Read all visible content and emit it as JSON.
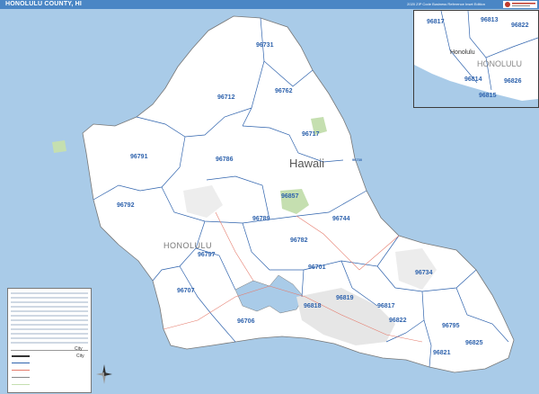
{
  "header": {
    "title": "HONOLULU COUNTY, HI",
    "subtitle": "2020 ZIP Code Business Reference Inset Edition"
  },
  "map": {
    "land_color": "#ffffff",
    "water_color": "#a9cbe8",
    "boundary_color": "#2f63ad",
    "place_labels": {
      "hawaii": "Hawaii",
      "honolulu": "HONOLULU"
    },
    "zips": {
      "z96731": "96731",
      "z96762": "96762",
      "z96712": "96712",
      "z96717": "96717",
      "z96791": "96791",
      "z96786": "96786",
      "z96792": "96792",
      "z96857": "96857",
      "z96789": "96789",
      "z96744": "96744",
      "z96782": "96782",
      "z96797": "96797",
      "z96701": "96701",
      "z96734": "96734",
      "z96707": "96707",
      "z96706": "96706",
      "z96819": "96819",
      "z96818": "96818",
      "z96817": "96817",
      "z96822": "96822",
      "z96795": "96795",
      "z96821": "96821",
      "z96825": "96825",
      "z96730": "96730"
    }
  },
  "inset": {
    "city": "Honolulu",
    "county": "HONOLULU",
    "zips": {
      "a": "96817",
      "b": "96813",
      "c": "96822",
      "d": "96814",
      "e": "96826",
      "f": "96815"
    }
  },
  "legend": {
    "city_label": "City",
    "city_label_2": "City"
  }
}
